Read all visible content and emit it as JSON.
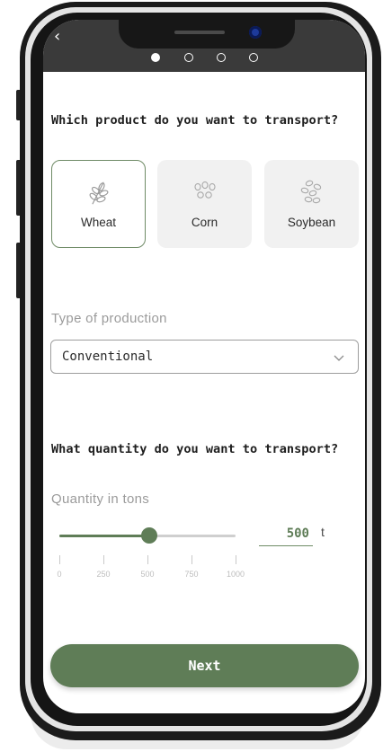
{
  "colors": {
    "accent": "#5f7d57",
    "accent_border": "#6f8b66",
    "card_bg": "#f1f1f1",
    "label_gray": "#9b9b9b"
  },
  "topbar": {
    "back_icon": "chevron-left-icon",
    "back_glyph": "‹",
    "steps_total": 4,
    "active_step": 1
  },
  "product": {
    "question": "Which product do you want to transport?",
    "options": [
      {
        "label": "Wheat",
        "icon": "wheat-icon",
        "selected": true
      },
      {
        "label": "Corn",
        "icon": "corn-icon",
        "selected": false
      },
      {
        "label": "Soybean",
        "icon": "soybean-icon",
        "selected": false
      }
    ]
  },
  "production": {
    "label": "Type of production",
    "selected_value": "Conventional",
    "icon": "chevron-down-icon"
  },
  "quantity": {
    "question": "What quantity do you want to transport?",
    "label": "Quantity in tons",
    "value": "500",
    "unit": "t",
    "slider_min": 0,
    "slider_max": 1000,
    "slider_value": 500,
    "ticks": [
      "0",
      "250",
      "500",
      "750",
      "1000"
    ]
  },
  "footer": {
    "next_label": "Next"
  }
}
